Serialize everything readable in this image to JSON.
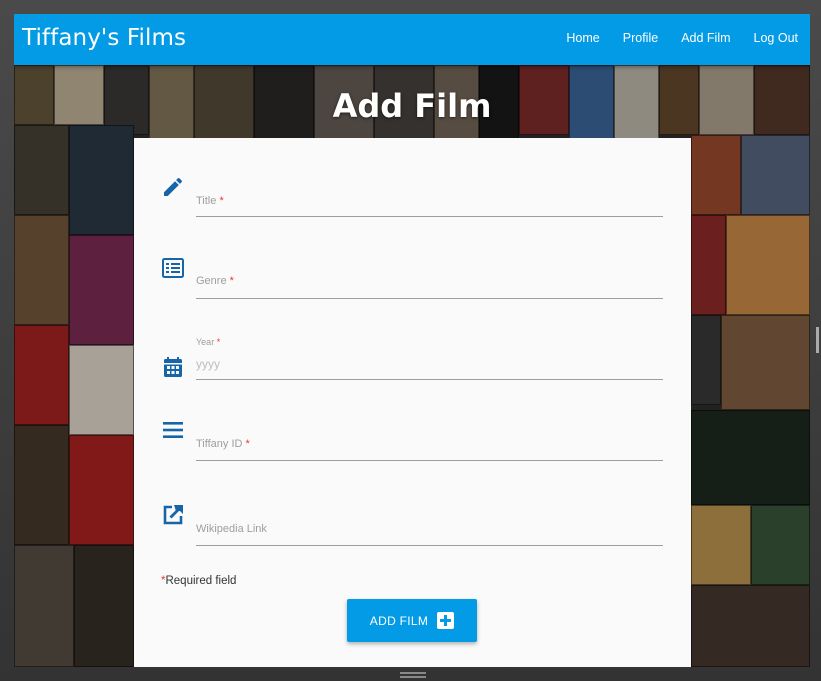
{
  "app": {
    "brand": "Tiffany's Films"
  },
  "nav": {
    "items": [
      {
        "label": "Home"
      },
      {
        "label": "Profile"
      },
      {
        "label": "Add Film"
      },
      {
        "label": "Log Out"
      }
    ]
  },
  "page": {
    "title": "Add Film"
  },
  "form": {
    "fields": [
      {
        "label": "Title",
        "required_mark": "*",
        "icon": "pencil-icon",
        "value": ""
      },
      {
        "label": "Genre",
        "required_mark": "*",
        "icon": "list-icon",
        "value": ""
      },
      {
        "label": "Year",
        "required_mark": "*",
        "icon": "calendar-icon",
        "placeholder": "yyyy",
        "value": ""
      },
      {
        "label": "Tiffany ID",
        "required_mark": "*",
        "icon": "menu-lines-icon",
        "value": ""
      },
      {
        "label": "Wikipedia Link",
        "icon": "external-link-icon",
        "value": ""
      }
    ],
    "required_note_mark": "*",
    "required_note": "Required field",
    "submit_label": "ADD FILM",
    "submit_icon": "plus-box-icon"
  },
  "colors": {
    "accent": "#039be5",
    "icon": "#1565a8",
    "required": "#e53935"
  }
}
